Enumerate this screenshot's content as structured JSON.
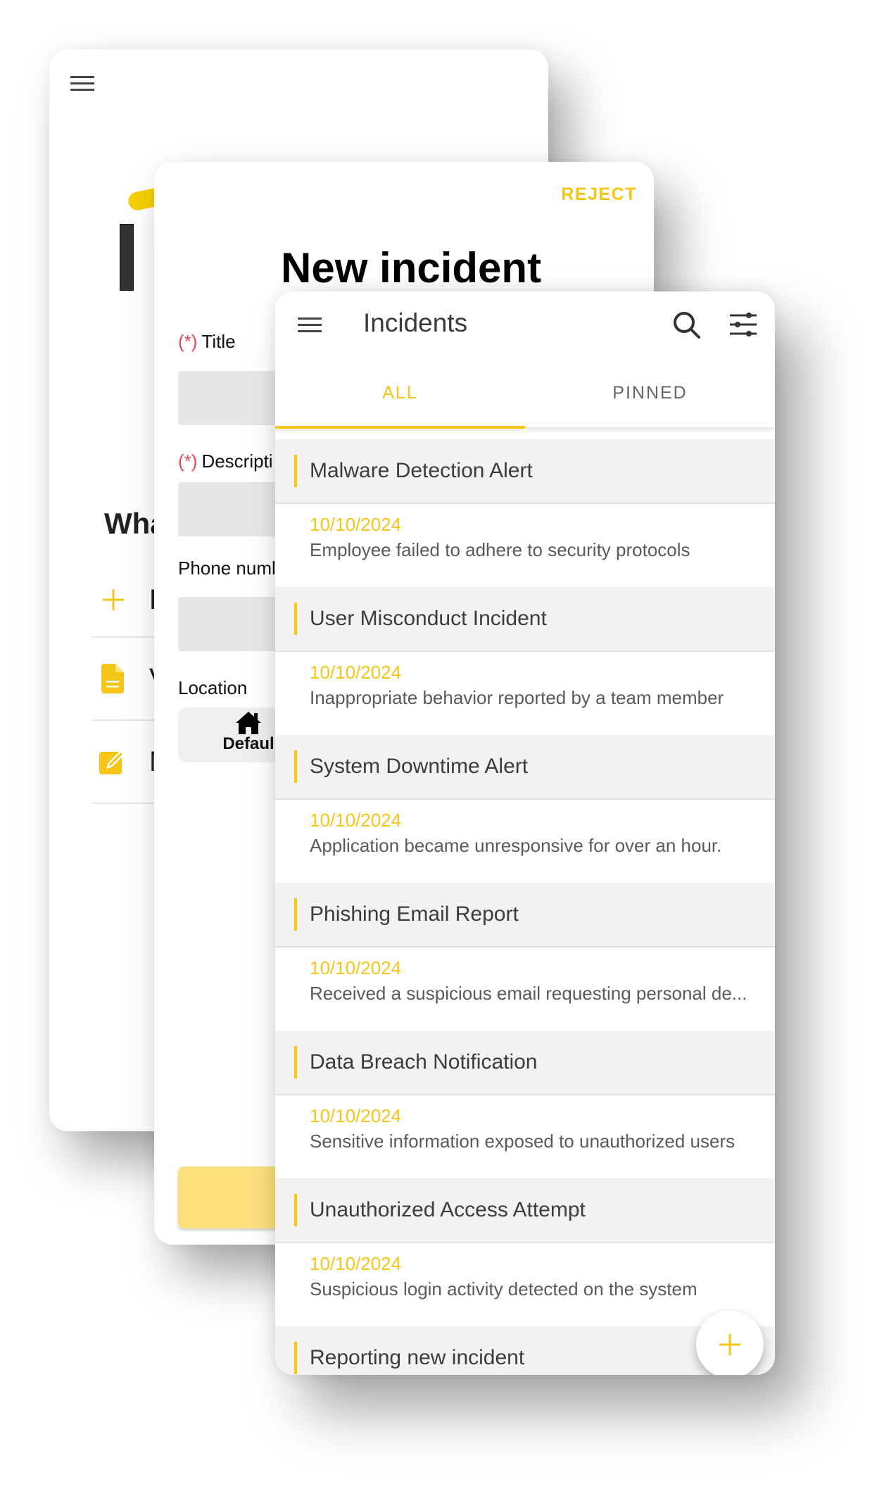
{
  "colors": {
    "accent": "#f5c518",
    "required": "#e04a5a",
    "header_bg": "#f2f2f2",
    "text_dark": "#3c3c3c",
    "submit_bg": "#fde07e"
  },
  "home_screen": {
    "menu_icon": "hamburger-menu-icon",
    "question_partial": "Wha",
    "menu_items": [
      {
        "icon": "plus-icon",
        "label_partial": "R"
      },
      {
        "icon": "document-icon",
        "label_partial": "V"
      },
      {
        "icon": "edit-icon",
        "label_partial": "M"
      }
    ]
  },
  "new_incident_form": {
    "reject_label": "REJECT",
    "title": "New incident",
    "required_marker": "(*)",
    "fields": {
      "title_label": "Title",
      "description_label_partial": "Descripti",
      "phone_label_partial": "Phone numl",
      "location_label": "Location"
    },
    "location_chip": {
      "icon": "home-icon",
      "label_partial": "Defaul"
    }
  },
  "incidents_screen": {
    "title": "Incidents",
    "actions": [
      "search-icon",
      "filter-sliders-icon"
    ],
    "tabs": [
      {
        "label": "ALL",
        "active": true
      },
      {
        "label": "PINNED",
        "active": false
      }
    ],
    "incidents": [
      {
        "title": "Malware Detection Alert",
        "date": "10/10/2024",
        "description": "Employee failed to adhere to security protocols"
      },
      {
        "title": "User Misconduct Incident",
        "date": "10/10/2024",
        "description": "Inappropriate behavior reported by a team member"
      },
      {
        "title": "System Downtime Alert",
        "date": "10/10/2024",
        "description": "Application became unresponsive for over an hour."
      },
      {
        "title": "Phishing Email Report",
        "date": "10/10/2024",
        "description": "Received a suspicious email requesting personal de..."
      },
      {
        "title": "Data Breach Notification",
        "date": "10/10/2024",
        "description": "Sensitive information exposed to unauthorized users"
      },
      {
        "title": "Unauthorized Access Attempt",
        "date": "10/10/2024",
        "description": "Suspicious login activity detected on the system"
      },
      {
        "title": "Reporting new incident",
        "date": "",
        "description": ""
      }
    ],
    "fab_icon": "plus-icon"
  }
}
